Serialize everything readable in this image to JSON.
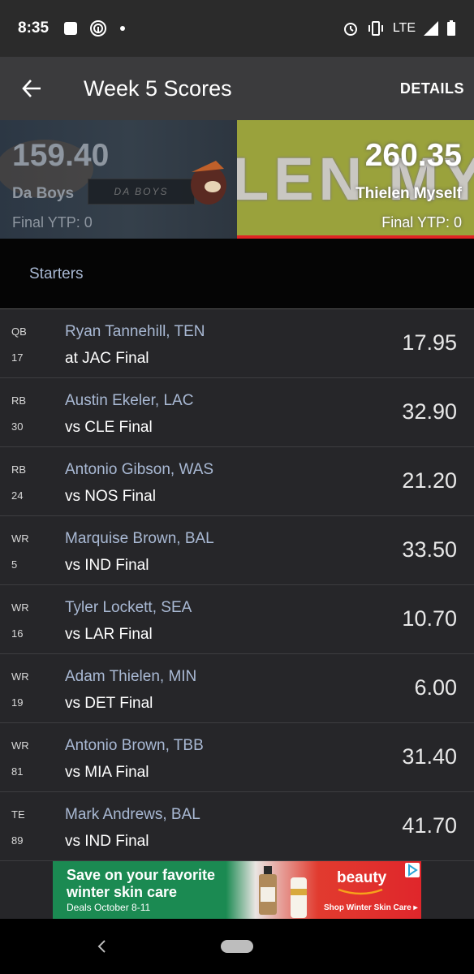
{
  "status_bar": {
    "time": "8:35",
    "network": "LTE"
  },
  "app_bar": {
    "title": "Week 5 Scores",
    "details": "DETAILS"
  },
  "matchup": {
    "left": {
      "score": "159.40",
      "name": "Da Boys",
      "ytp": "Final YTP: 0",
      "logo_text": "DA BOYS"
    },
    "right": {
      "score": "260.35",
      "name": "Thielen Myself",
      "ytp": "Final YTP: 0",
      "banner_text": "LEN MYS"
    }
  },
  "section_label": "Starters",
  "players": [
    {
      "pos": "QB",
      "num": "17",
      "name": "Ryan Tannehill, TEN",
      "game": "at JAC  Final",
      "points": "17.95"
    },
    {
      "pos": "RB",
      "num": "30",
      "name": "Austin Ekeler, LAC",
      "game": "vs CLE  Final",
      "points": "32.90"
    },
    {
      "pos": "RB",
      "num": "24",
      "name": "Antonio Gibson, WAS",
      "game": "vs NOS  Final",
      "points": "21.20"
    },
    {
      "pos": "WR",
      "num": "5",
      "name": "Marquise Brown, BAL",
      "game": "vs IND  Final",
      "points": "33.50"
    },
    {
      "pos": "WR",
      "num": "16",
      "name": "Tyler Lockett, SEA",
      "game": "vs LAR  Final",
      "points": "10.70"
    },
    {
      "pos": "WR",
      "num": "19",
      "name": "Adam Thielen, MIN",
      "game": "vs DET  Final",
      "points": "6.00"
    },
    {
      "pos": "WR",
      "num": "81",
      "name": "Antonio Brown, TBB",
      "game": "vs MIA  Final",
      "points": "31.40"
    },
    {
      "pos": "TE",
      "num": "89",
      "name": "Mark Andrews, BAL",
      "game": "vs IND  Final",
      "points": "41.70"
    }
  ],
  "ad": {
    "headline": "Save on your favorite winter skin care",
    "sub": "Deals October 8-11",
    "brand": "beauty",
    "cta": "Shop Winter Skin Care ▸"
  },
  "colors": {
    "accent_red": "#e02424",
    "name_blue": "#a9b9d4",
    "right_team_bg": "#9aa23c",
    "ad_green": "#1b8a52"
  }
}
